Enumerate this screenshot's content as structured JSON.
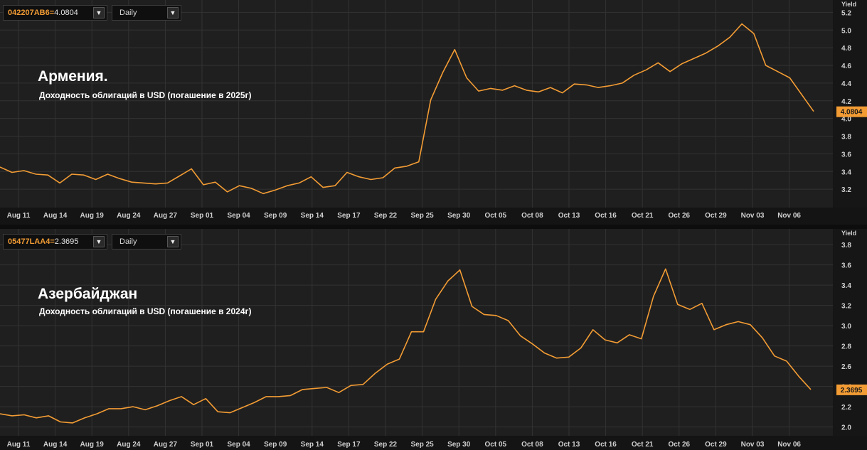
{
  "chart_data": [
    {
      "type": "line",
      "symbol": "042207AB6",
      "last_value": "4.0804",
      "period": "Daily",
      "title": "Армения.",
      "subtitle": "Доходность облигаций в USD (погашение в 2025г)",
      "ylabel": "Yield",
      "ylim": [
        3.0,
        5.3
      ],
      "yticks": [
        "3.2",
        "3.4",
        "3.6",
        "3.8",
        "4.0",
        "4.2",
        "4.4",
        "4.6",
        "4.8",
        "5.0",
        "5.2"
      ],
      "xticks": [
        "Aug 11",
        "Aug 14",
        "Aug 19",
        "Aug 24",
        "Aug 27",
        "Sep 01",
        "Sep 04",
        "Sep 09",
        "Sep 14",
        "Sep 17",
        "Sep 22",
        "Sep 25",
        "Sep 30",
        "Oct 05",
        "Oct 08",
        "Oct 13",
        "Oct 16",
        "Oct 21",
        "Oct 26",
        "Oct 29",
        "Nov 03",
        "Nov 06"
      ],
      "grid": true,
      "line_color": "#f39c34",
      "series": [
        {
          "values": [
            3.45,
            3.39,
            3.41,
            3.37,
            3.36,
            3.27,
            3.37,
            3.36,
            3.31,
            3.37,
            3.32,
            3.28,
            3.27,
            3.26,
            3.27,
            3.35,
            3.43,
            3.25,
            3.28,
            3.17,
            3.24,
            3.21,
            3.15,
            3.19,
            3.24,
            3.27,
            3.34,
            3.22,
            3.24,
            3.39,
            3.34,
            3.31,
            3.33,
            3.44,
            3.46,
            3.51,
            4.21,
            4.52,
            4.78,
            4.46,
            4.31,
            4.34,
            4.32,
            4.37,
            4.32,
            4.3,
            4.35,
            4.29,
            4.39,
            4.38,
            4.35,
            4.37,
            4.4,
            4.49,
            4.55,
            4.63,
            4.53,
            4.62,
            4.68,
            4.74,
            4.82,
            4.92,
            5.07,
            4.96,
            4.6,
            4.53,
            4.46,
            4.27,
            4.08
          ]
        }
      ]
    },
    {
      "type": "line",
      "symbol": "05477LAA4",
      "last_value": "2.3695",
      "period": "Daily",
      "title": "Азербайджан",
      "subtitle": "Доходность облигаций в USD (погашение в 2024г)",
      "ylabel": "Yield",
      "ylim": [
        1.92,
        3.92
      ],
      "yticks": [
        "2.0",
        "2.2",
        "2.4",
        "2.6",
        "2.8",
        "3.0",
        "3.2",
        "3.4",
        "3.6",
        "3.8"
      ],
      "xticks": [
        "Aug 11",
        "Aug 14",
        "Aug 19",
        "Aug 24",
        "Aug 27",
        "Sep 01",
        "Sep 04",
        "Sep 09",
        "Sep 14",
        "Sep 17",
        "Sep 22",
        "Sep 25",
        "Sep 30",
        "Oct 05",
        "Oct 08",
        "Oct 13",
        "Oct 16",
        "Oct 21",
        "Oct 26",
        "Oct 29",
        "Nov 03",
        "Nov 06"
      ],
      "grid": true,
      "line_color": "#f39c34",
      "series": [
        {
          "values": [
            2.13,
            2.11,
            2.12,
            2.09,
            2.11,
            2.05,
            2.04,
            2.09,
            2.13,
            2.18,
            2.18,
            2.2,
            2.17,
            2.21,
            2.26,
            2.3,
            2.22,
            2.28,
            2.15,
            2.14,
            2.19,
            2.24,
            2.3,
            2.3,
            2.31,
            2.37,
            2.38,
            2.39,
            2.34,
            2.41,
            2.42,
            2.53,
            2.62,
            2.67,
            2.94,
            2.94,
            3.26,
            3.44,
            3.55,
            3.19,
            3.11,
            3.1,
            3.05,
            2.9,
            2.82,
            2.73,
            2.68,
            2.69,
            2.78,
            2.96,
            2.86,
            2.83,
            2.91,
            2.87,
            3.29,
            3.56,
            3.21,
            3.16,
            3.22,
            2.96,
            3.01,
            3.04,
            3.01,
            2.88,
            2.7,
            2.65,
            2.5,
            2.37
          ]
        }
      ]
    }
  ]
}
